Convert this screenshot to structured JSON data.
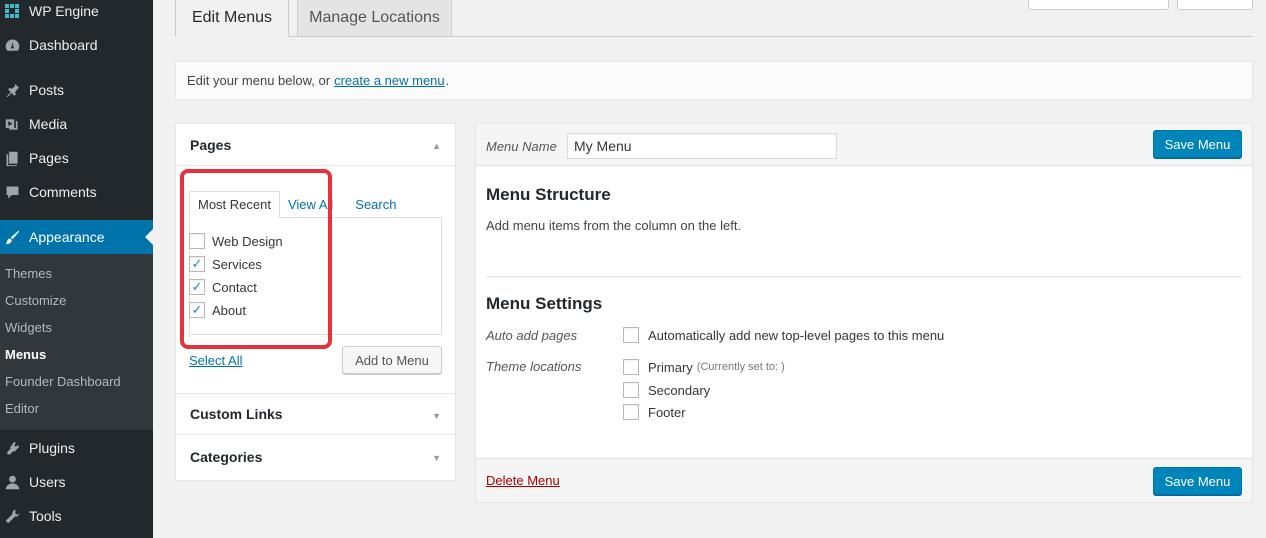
{
  "sidebar": {
    "items": [
      {
        "label": "WP Engine",
        "icon": "wp-engine-icon"
      },
      {
        "label": "Dashboard",
        "icon": "dashboard-icon"
      },
      {
        "label": "Posts",
        "icon": "pin-icon"
      },
      {
        "label": "Media",
        "icon": "media-icon"
      },
      {
        "label": "Pages",
        "icon": "pages-icon"
      },
      {
        "label": "Comments",
        "icon": "comment-icon"
      },
      {
        "label": "Appearance",
        "icon": "brush-icon"
      },
      {
        "label": "Plugins",
        "icon": "plugin-icon"
      },
      {
        "label": "Users",
        "icon": "user-icon"
      },
      {
        "label": "Tools",
        "icon": "wrench-icon"
      }
    ],
    "submenu": [
      "Themes",
      "Customize",
      "Widgets",
      "Menus",
      "Founder Dashboard",
      "Editor"
    ],
    "active_color": "#0073aa"
  },
  "tabs": {
    "edit": "Edit Menus",
    "manage": "Manage Locations"
  },
  "notice": {
    "prefix": "Edit your menu below, or",
    "link": "create a new menu",
    "suffix": "."
  },
  "accordion": {
    "pages_title": "Pages",
    "panel_tabs": [
      "Most Recent",
      "View All",
      "Search"
    ],
    "pages": [
      {
        "label": "Web Design",
        "checked": false
      },
      {
        "label": "Services",
        "checked": true
      },
      {
        "label": "Contact",
        "checked": true
      },
      {
        "label": "About",
        "checked": true
      }
    ],
    "select_all": "Select All",
    "add_to_menu": "Add to Menu",
    "custom_links": "Custom Links",
    "categories": "Categories",
    "highlight_color": "#e8313a"
  },
  "menu": {
    "name_label": "Menu Name",
    "name_value": "My Menu",
    "save": "Save Menu",
    "structure_title": "Menu Structure",
    "structure_hint": "Add menu items from the column on the left.",
    "settings_title": "Menu Settings",
    "auto_add_label": "Auto add pages",
    "auto_add_text": "Automatically add new top-level pages to this menu",
    "theme_locations_label": "Theme locations",
    "locations": [
      {
        "label": "Primary",
        "note": "(Currently set to: )"
      },
      {
        "label": "Secondary",
        "note": ""
      },
      {
        "label": "Footer",
        "note": ""
      }
    ],
    "delete": "Delete Menu"
  }
}
